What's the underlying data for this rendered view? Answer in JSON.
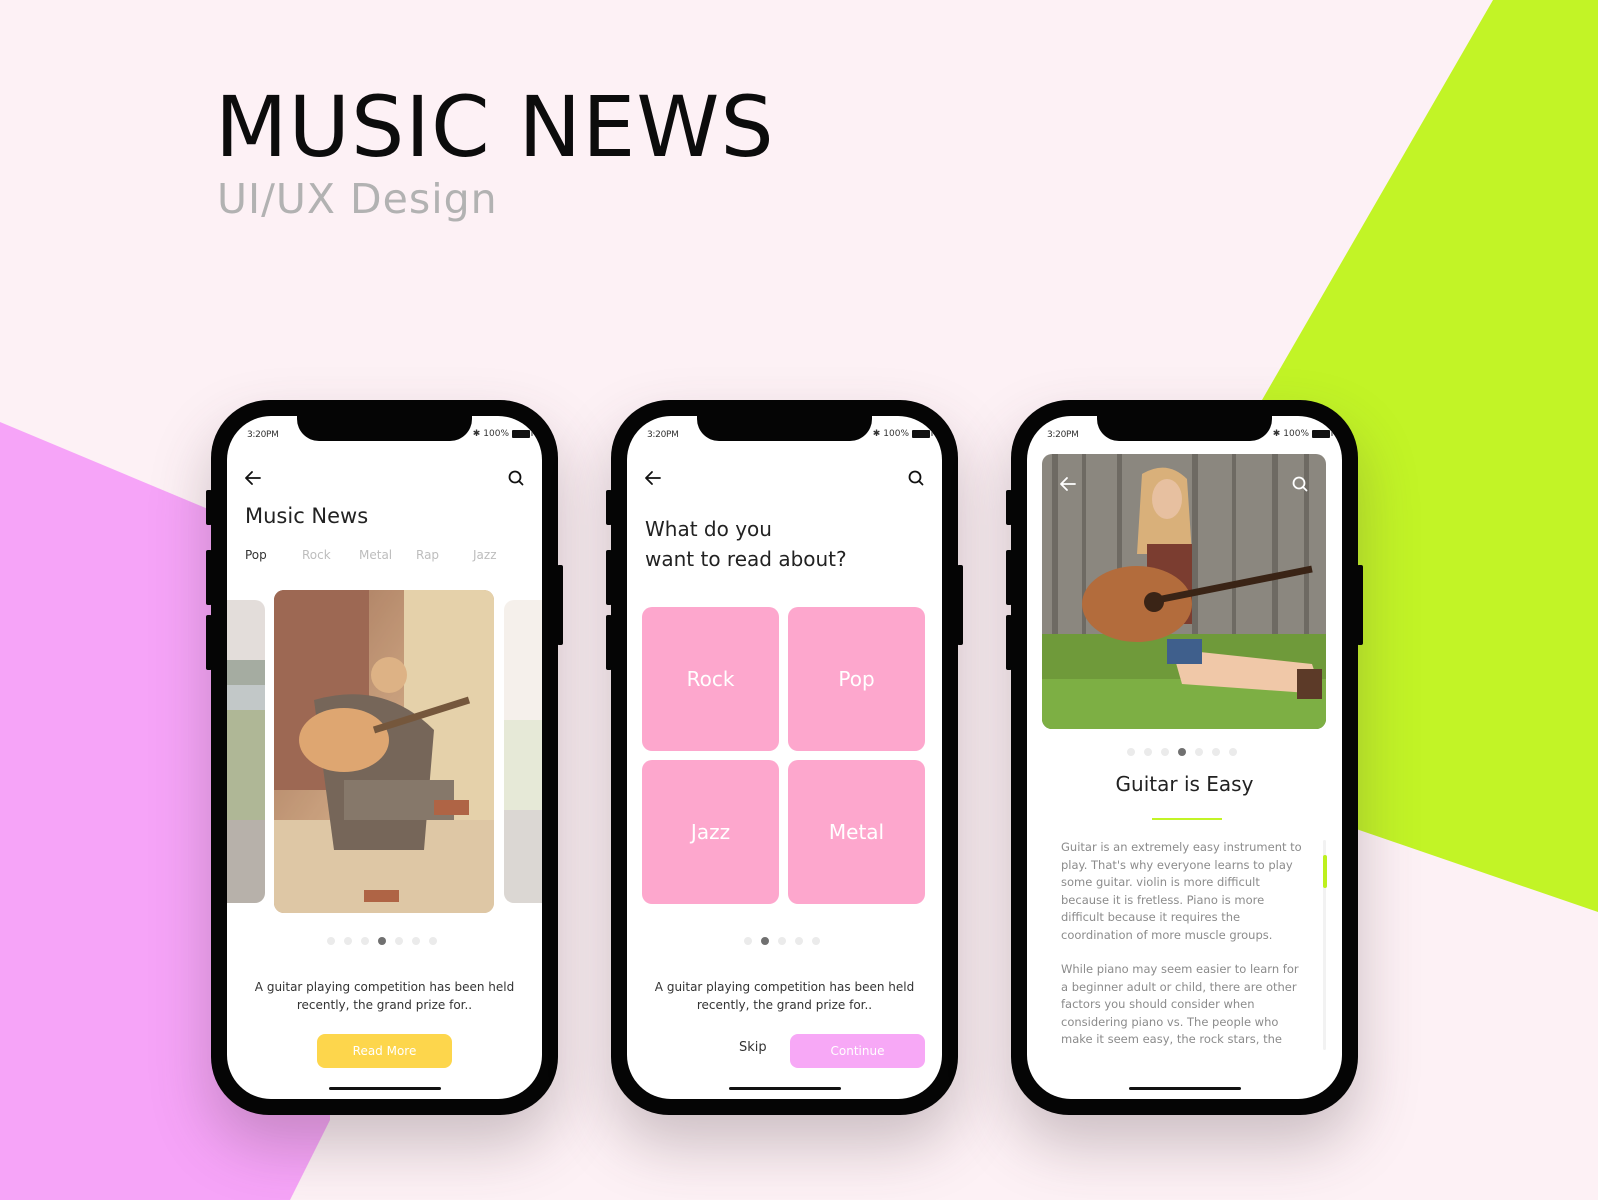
{
  "hero": {
    "title": "MUSIC NEWS",
    "subtitle": "UI/UX Design"
  },
  "colors": {
    "background": "#fdf1f5",
    "pink_shape": "#f6a4f8",
    "lime_shape": "#c2f426",
    "read_more": "#fdd64c",
    "genre_tile": "#fda7cd",
    "continue": "#f7a8f6",
    "accent_line": "#c2f426"
  },
  "status_bar": {
    "time": "3:20PM",
    "battery": "100%"
  },
  "phone1": {
    "title": "Music News",
    "tabs": [
      {
        "label": "Pop",
        "active": true
      },
      {
        "label": "Rock",
        "active": false
      },
      {
        "label": "Metal",
        "active": false
      },
      {
        "label": "Rap",
        "active": false
      },
      {
        "label": "Jazz",
        "active": false
      }
    ],
    "pager": {
      "count": 7,
      "active_index": 3
    },
    "excerpt_line1": "A guitar playing competition has been held",
    "excerpt_line2": "recently, the grand prize for..",
    "read_more_label": "Read More"
  },
  "phone2": {
    "question_line1": "What do you",
    "question_line2": "want to read about?",
    "genres": [
      "Rock",
      "Pop",
      "Jazz",
      "Metal"
    ],
    "pager": {
      "count": 5,
      "active_index": 1
    },
    "excerpt_line1": "A guitar playing competition has been held",
    "excerpt_line2": "recently, the grand prize for..",
    "skip_label": "Skip",
    "continue_label": "Continue"
  },
  "phone3": {
    "pager": {
      "count": 7,
      "active_index": 3
    },
    "article_title": "Guitar is Easy",
    "paragraph1": "Guitar is an extremely easy instrument to play. That's why everyone learns to play some guitar. violin is more difficult because it is fretless. Piano is more difficult because it requires the coordination of more muscle groups.",
    "paragraph2": "While piano may seem easier to learn for a beginner adult or child, there are other factors you should consider when considering piano vs. The people who make it seem easy, the rock stars, the"
  },
  "icons": {
    "back": "arrow-left-icon",
    "search": "search-icon",
    "bluetooth": "bluetooth-icon",
    "battery": "battery-icon"
  }
}
